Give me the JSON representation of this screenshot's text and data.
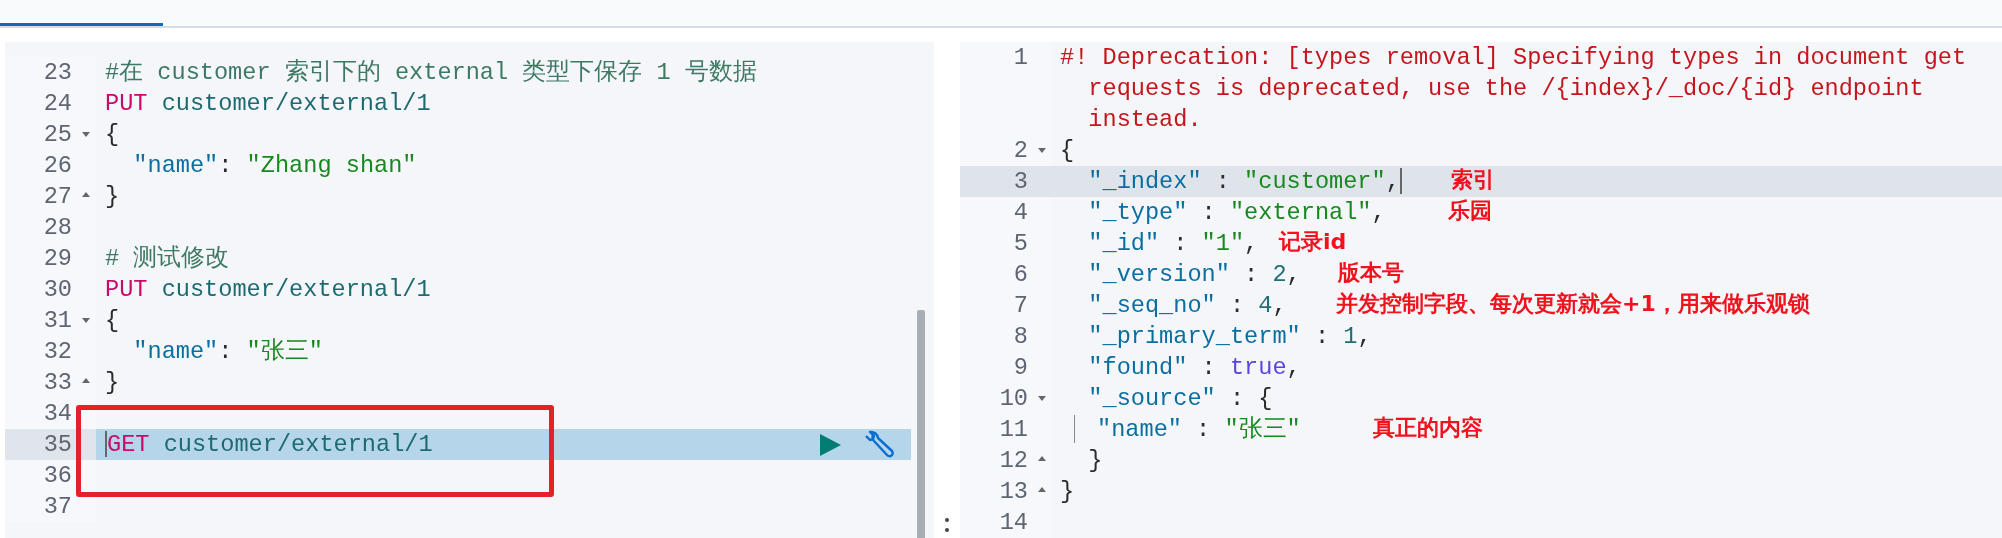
{
  "tab_bar": {
    "tabs": [
      {
        "selected": true
      }
    ]
  },
  "request_editor": {
    "lines": [
      {
        "number": "23",
        "tokens": [
          {
            "kind": "comment",
            "text": "#在 customer 索引下的 external 类型下保存 1 号数据"
          }
        ]
      },
      {
        "number": "24",
        "tokens": [
          {
            "kind": "method",
            "text": "PUT"
          },
          {
            "kind": "url",
            "text": " customer/external/1"
          }
        ]
      },
      {
        "number": "25",
        "fold_start": true,
        "tokens": [
          {
            "kind": "punct",
            "text": "{"
          }
        ]
      },
      {
        "number": "26",
        "tokens": [
          {
            "kind": "key",
            "text": "  \"name\""
          },
          {
            "kind": "punct",
            "text": ": "
          },
          {
            "kind": "string",
            "text": "\"Zhang shan\""
          }
        ]
      },
      {
        "number": "27",
        "fold_end": true,
        "tokens": [
          {
            "kind": "punct",
            "text": "}"
          }
        ]
      },
      {
        "number": "28"
      },
      {
        "number": "29",
        "tokens": [
          {
            "kind": "comment",
            "text": "# 测试修改"
          }
        ]
      },
      {
        "number": "30",
        "tokens": [
          {
            "kind": "method",
            "text": "PUT"
          },
          {
            "kind": "url",
            "text": " customer/external/1"
          }
        ]
      },
      {
        "number": "31",
        "fold_start": true,
        "tokens": [
          {
            "kind": "punct",
            "text": "{"
          }
        ]
      },
      {
        "number": "32",
        "tokens": [
          {
            "kind": "key",
            "text": "  \"name\""
          },
          {
            "kind": "punct",
            "text": ": "
          },
          {
            "kind": "string",
            "text": "\"张三\""
          }
        ]
      },
      {
        "number": "33",
        "fold_end": true,
        "tokens": [
          {
            "kind": "punct",
            "text": "}"
          }
        ]
      },
      {
        "number": "34"
      },
      {
        "number": "35",
        "active": true,
        "cursor_start": true,
        "actions": true,
        "tokens": [
          {
            "kind": "method",
            "text": "GET"
          },
          {
            "kind": "url",
            "text": " customer/external/1"
          }
        ]
      },
      {
        "number": "36"
      },
      {
        "number": "37"
      }
    ]
  },
  "response_viewer": {
    "lines": [
      {
        "number": "1",
        "tokens": [
          {
            "kind": "warning",
            "text": "#! Deprecation: [types removal] Specifying types in document get requests is deprecated, use the /{index}/_doc/{id} endpoint instead."
          }
        ]
      },
      {
        "number": "2",
        "fold_start": true,
        "tokens": [
          {
            "kind": "punct",
            "text": "{"
          }
        ]
      },
      {
        "number": "3",
        "active": true,
        "cursor_end": true,
        "note": "索引",
        "tokens": [
          {
            "kind": "key",
            "text": "  \"_index\""
          },
          {
            "kind": "punct",
            "text": " : "
          },
          {
            "kind": "string",
            "text": "\"customer\""
          },
          {
            "kind": "punct",
            "text": ","
          }
        ]
      },
      {
        "number": "4",
        "note": "乐园",
        "tokens": [
          {
            "kind": "key",
            "text": "  \"_type\""
          },
          {
            "kind": "punct",
            "text": " : "
          },
          {
            "kind": "string",
            "text": "\"external\""
          },
          {
            "kind": "punct",
            "text": ","
          }
        ]
      },
      {
        "number": "5",
        "note": "记录id",
        "tokens": [
          {
            "kind": "key",
            "text": "  \"_id\""
          },
          {
            "kind": "punct",
            "text": " : "
          },
          {
            "kind": "string",
            "text": "\"1\""
          },
          {
            "kind": "punct",
            "text": ","
          }
        ]
      },
      {
        "number": "6",
        "note": "版本号",
        "tokens": [
          {
            "kind": "key",
            "text": "  \"_version\""
          },
          {
            "kind": "punct",
            "text": " : "
          },
          {
            "kind": "number",
            "text": "2"
          },
          {
            "kind": "punct",
            "text": ","
          }
        ]
      },
      {
        "number": "7",
        "note": "并发控制字段、每次更新就会+1，用来做乐观锁",
        "tokens": [
          {
            "kind": "key",
            "text": "  \"_seq_no\""
          },
          {
            "kind": "punct",
            "text": " : "
          },
          {
            "kind": "number",
            "text": "4"
          },
          {
            "kind": "punct",
            "text": ","
          }
        ]
      },
      {
        "number": "8",
        "tokens": [
          {
            "kind": "key",
            "text": "  \"_primary_term\""
          },
          {
            "kind": "punct",
            "text": " : "
          },
          {
            "kind": "number",
            "text": "1"
          },
          {
            "kind": "punct",
            "text": ","
          }
        ]
      },
      {
        "number": "9",
        "tokens": [
          {
            "kind": "key",
            "text": "  \"found\""
          },
          {
            "kind": "punct",
            "text": " : "
          },
          {
            "kind": "bool",
            "text": "true"
          },
          {
            "kind": "punct",
            "text": ","
          }
        ]
      },
      {
        "number": "10",
        "fold_start": true,
        "tokens": [
          {
            "kind": "key",
            "text": "  \"_source\""
          },
          {
            "kind": "punct",
            "text": " : {"
          }
        ]
      },
      {
        "number": "11",
        "guide": true,
        "note": "真正的内容",
        "tokens": [
          {
            "kind": "key",
            "text": "\"name\""
          },
          {
            "kind": "punct",
            "text": " : "
          },
          {
            "kind": "string",
            "text": "\"张三\""
          }
        ]
      },
      {
        "number": "12",
        "fold_end": true,
        "tokens": [
          {
            "kind": "punct",
            "text": "  }"
          }
        ]
      },
      {
        "number": "13",
        "fold_end": true,
        "tokens": [
          {
            "kind": "punct",
            "text": "}"
          }
        ]
      },
      {
        "number": "14"
      }
    ]
  }
}
